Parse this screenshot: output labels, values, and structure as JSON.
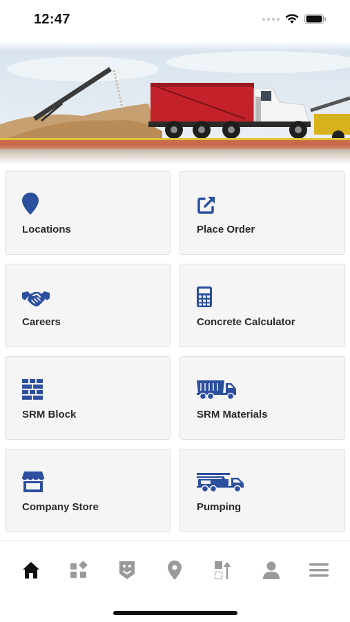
{
  "status_bar": {
    "time": "12:47"
  },
  "tiles": [
    {
      "label": "Locations",
      "icon": "location-pin-icon"
    },
    {
      "label": "Place Order",
      "icon": "external-link-icon"
    },
    {
      "label": "Careers",
      "icon": "handshake-icon"
    },
    {
      "label": "Concrete Calculator",
      "icon": "calculator-icon"
    },
    {
      "label": "SRM Block",
      "icon": "brick-wall-icon"
    },
    {
      "label": "SRM Materials",
      "icon": "dump-truck-icon"
    },
    {
      "label": "Company Store",
      "icon": "storefront-icon"
    },
    {
      "label": "Pumping",
      "icon": "pump-truck-icon"
    }
  ],
  "bottom_nav": [
    {
      "icon": "home-icon",
      "active": true
    },
    {
      "icon": "apps-grid-icon",
      "active": false
    },
    {
      "icon": "badge-icon",
      "active": false
    },
    {
      "icon": "location-icon",
      "active": false
    },
    {
      "icon": "sort-icon",
      "active": false
    },
    {
      "icon": "profile-icon",
      "active": false
    },
    {
      "icon": "menu-icon",
      "active": false
    }
  ],
  "colors": {
    "accent": "#2c4f9e",
    "nav_active": "#111111",
    "nav_inactive": "#9a9a9a",
    "tile_bg": "#f5f5f6"
  }
}
